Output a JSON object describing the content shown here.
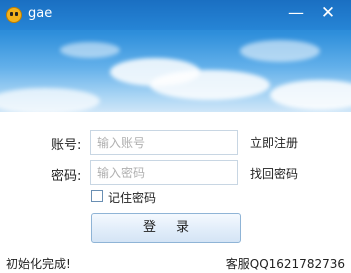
{
  "window": {
    "title": "gae"
  },
  "controls": {
    "minimize_glyph": "—",
    "close_glyph": "✕"
  },
  "form": {
    "account_label": "账号:",
    "account_placeholder": "输入账号",
    "account_value": "",
    "password_label": "密码:",
    "password_placeholder": "输入密码",
    "password_value": "",
    "register_link": "立即注册",
    "recover_link": "找回密码",
    "remember_label": "记住密码",
    "remember_checked": false,
    "login_button": "登录"
  },
  "footer": {
    "status": "初始化完成!",
    "support": "客服QQ1621782736"
  },
  "colors": {
    "titlebar": "#1a6fc2",
    "sky": "#63b0ea",
    "border": "#c8d6e3",
    "button": "#e3eefa"
  },
  "icons": {
    "app": "smiley-app-icon",
    "minimize": "minimize-icon",
    "close": "close-icon",
    "checkbox": "checkbox-icon"
  }
}
